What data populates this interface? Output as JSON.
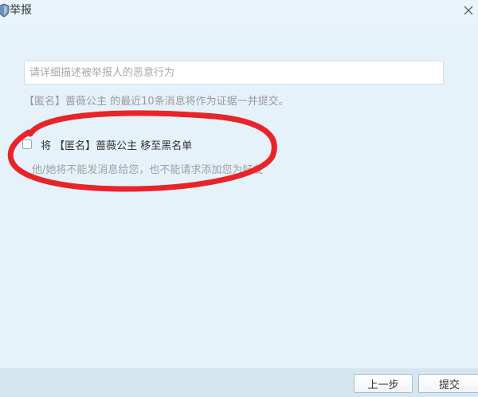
{
  "window": {
    "title": "举报"
  },
  "report": {
    "placeholder": "请详细描述被举报人的恶意行为",
    "value": "",
    "evidence_note": "【匿名】蔷薇公主 的最近10条消息将作为证据一并提交。"
  },
  "blacklist": {
    "checked": false,
    "label": "将 【匿名】蔷薇公主 移至黑名单",
    "note": "他/她将不能发消息给您，也不能请求添加您为好友"
  },
  "footer": {
    "prev_label": "上一步",
    "submit_label": "提交"
  },
  "colors": {
    "background": "#e6f2fa",
    "footer": "#d6e6f1",
    "annotation_red": "#e8242a"
  },
  "icons": {
    "app": "shield-icon",
    "close": "close-icon"
  }
}
